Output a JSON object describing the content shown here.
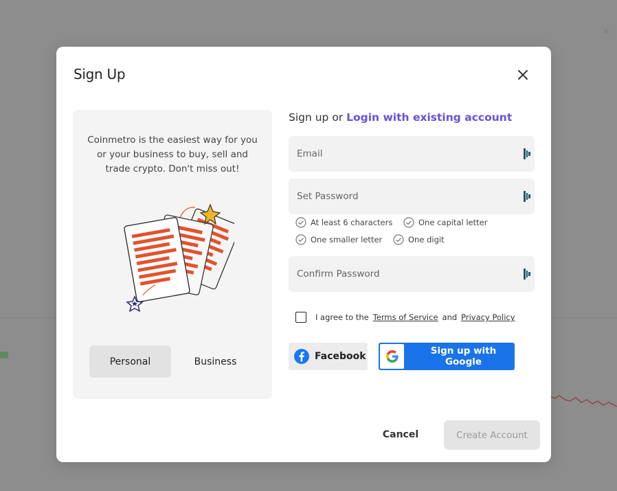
{
  "modal": {
    "title": "Sign Up",
    "close_icon": "close-icon"
  },
  "left_panel": {
    "tagline": "Coinmetro is the easiest way for you or your business to buy, sell and trade crypto. Don't miss out!",
    "illustration_icon": "documents-illustration",
    "account_types": [
      {
        "label": "Personal",
        "selected": true
      },
      {
        "label": "Business",
        "selected": false
      }
    ]
  },
  "form": {
    "intro": "Sign up or",
    "login_link": "Login with existing account",
    "email": {
      "placeholder": "Email",
      "value": ""
    },
    "password": {
      "placeholder": "Set Password",
      "value": ""
    },
    "confirm_password": {
      "placeholder": "Confirm Password",
      "value": ""
    },
    "password_rules": [
      "At least 6 characters",
      "One capital letter",
      "One smaller letter",
      "One digit"
    ],
    "agree": {
      "prefix": "I agree to the",
      "terms": "Terms of Service",
      "and": "and",
      "privacy": "Privacy Policy",
      "checked": false
    },
    "facebook_label": "Facebook",
    "google_label": "Sign up with Google"
  },
  "footer": {
    "cancel_label": "Cancel",
    "create_label": "Create Account"
  },
  "colors": {
    "accent": "#6b4fe0",
    "google_blue": "#1a73e8",
    "facebook_blue": "#1877f2",
    "illustration_orange": "#e0532e",
    "key_icon_teal": "#1f5a66"
  }
}
